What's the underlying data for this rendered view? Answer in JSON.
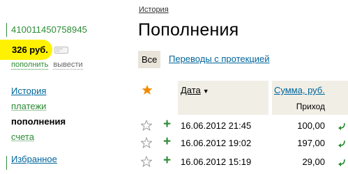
{
  "account": {
    "number": "410011450758945",
    "balance": "326 руб.",
    "actions": {
      "topup": "пополнить",
      "withdraw": "вывести"
    }
  },
  "nav": {
    "history": "История",
    "payments": "платежи",
    "topups": "пополнения",
    "invoices": "счета",
    "favorites": "Избранное"
  },
  "main": {
    "breadcrumb": "История",
    "title": "Пополнения",
    "filters": {
      "all": "Все",
      "protected": "Переводы с протекцией"
    },
    "table": {
      "headers": {
        "date": "Дата",
        "sort_indicator": "▼",
        "sum": "Сумма, руб.",
        "sum_sub": "Приход"
      },
      "rows": [
        {
          "date": "16.06.2012 21:45",
          "amount": "100,00"
        },
        {
          "date": "16.06.2012 19:02",
          "amount": "197,00"
        },
        {
          "date": "16.06.2012 15:19",
          "amount": "29,00"
        }
      ]
    }
  },
  "colors": {
    "accent_green": "#2a8a33",
    "link_blue": "#00659b",
    "highlight_yellow": "#fff200",
    "star_orange": "#f08c00",
    "header_bg": "#f1eee6"
  },
  "icons": [
    "wallet-icon",
    "star-icon",
    "plus-icon",
    "return-arrow-icon",
    "sort-arrow-icon",
    "favorites-icon"
  ]
}
